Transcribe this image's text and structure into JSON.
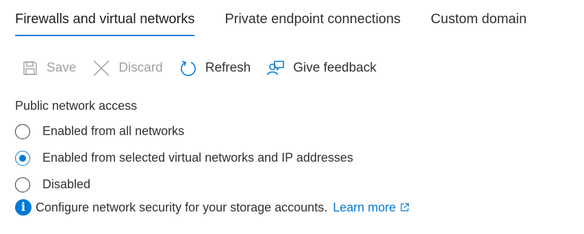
{
  "tabs": [
    {
      "label": "Firewalls and virtual networks",
      "active": true
    },
    {
      "label": "Private endpoint connections",
      "active": false
    },
    {
      "label": "Custom domain",
      "active": false
    }
  ],
  "toolbar": {
    "save_label": "Save",
    "discard_label": "Discard",
    "refresh_label": "Refresh",
    "feedback_label": "Give feedback"
  },
  "public_access": {
    "label": "Public network access",
    "options": [
      {
        "label": "Enabled from all networks",
        "selected": false
      },
      {
        "label": "Enabled from selected virtual networks and IP addresses",
        "selected": true
      },
      {
        "label": "Disabled",
        "selected": false
      }
    ]
  },
  "info": {
    "text": "Configure network security for your storage accounts.",
    "link_label": "Learn more"
  },
  "colors": {
    "accent": "#0078d4",
    "text": "#323130",
    "disabled": "#a19f9d"
  },
  "icons": {
    "save": "save-icon",
    "discard": "close-icon",
    "refresh": "refresh-icon",
    "feedback": "feedback-icon",
    "info": "info-icon",
    "external": "external-link-icon"
  }
}
